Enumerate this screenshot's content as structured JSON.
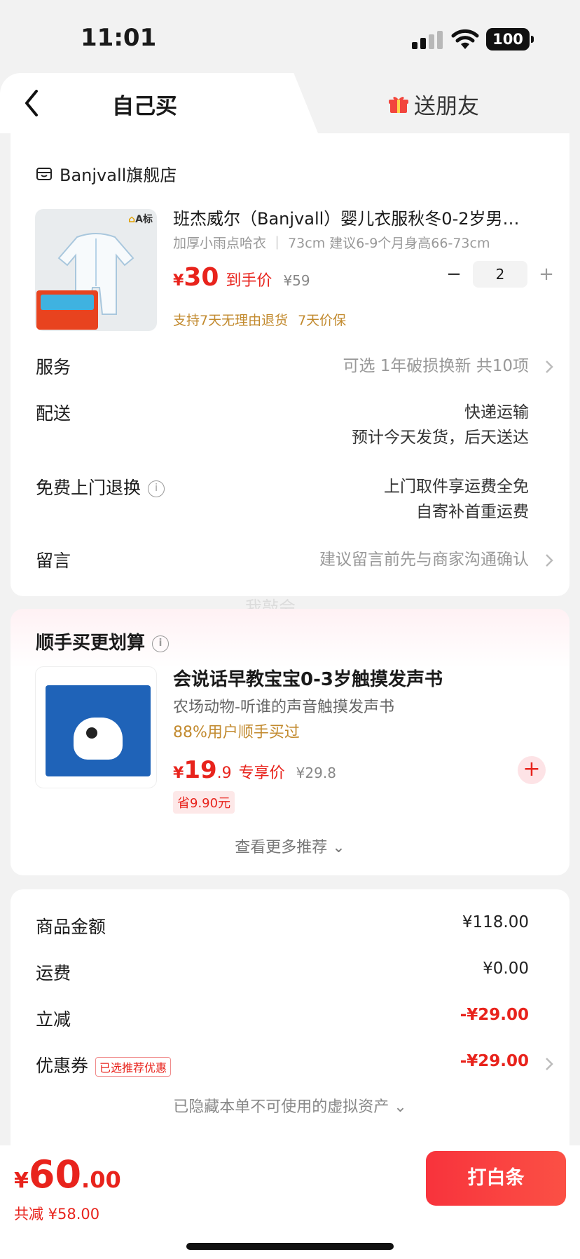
{
  "status_bar": {
    "time": "11:01",
    "battery": "100"
  },
  "tabs": {
    "self": "自己买",
    "gift": "送朋友"
  },
  "store": {
    "name": "Banjvall旗舰店"
  },
  "product": {
    "badge": "A标",
    "title": "班杰威尔（Banjvall）婴儿衣服秋冬0-2岁男…",
    "spec": "加厚小雨点哈衣 ｜ 73cm 建议6-9个月身高66-73cm",
    "currency": "¥",
    "price": "30",
    "price_label": "到手价",
    "original_price": "¥59",
    "quantity": "2",
    "minus": "−",
    "plus": "+",
    "guarantee_1": "支持7天无理由退货",
    "guarantee_2": "7天价保"
  },
  "order_rows": {
    "service_label": "服务",
    "service_value": "可选 1年破损换新 共10项",
    "delivery_label": "配送",
    "delivery_line1": "快递运输",
    "delivery_line2": "预计今天发货，后天送达",
    "return_label": "免费上门退换",
    "return_line1": "上门取件享运费全免",
    "return_line2": "自寄补首重运费",
    "note_label": "留言",
    "note_value": "建议留言前先与商家沟通确认"
  },
  "watermark": "我敲会",
  "recommend": {
    "title": "顺手买更划算",
    "name": "会说话早教宝宝0-3岁触摸发声书",
    "subtitle": "农场动物-听谁的声音触摸发声书",
    "rate": "88%用户顺手买过",
    "currency": "¥",
    "price_int": "19",
    "price_dec": ".9",
    "price_label": "专享价",
    "original_price": "¥29.8",
    "save": "省9.90元",
    "add": "+",
    "more": "查看更多推荐 ⌄"
  },
  "summary": {
    "goods_label": "商品金额",
    "goods_value": "¥118.00",
    "shipping_label": "运费",
    "shipping_value": "¥0.00",
    "discount_label": "立减",
    "discount_value": "-¥29.00",
    "coupon_label": "优惠券",
    "coupon_tag": "已选推荐优惠",
    "coupon_value": "-¥29.00",
    "hidden_assets": "已隐藏本单不可使用的虚拟资产 ⌄"
  },
  "footer": {
    "currency": "¥",
    "total_int": "60",
    "total_dec": ".00",
    "saved": "共减 ¥58.00",
    "pay_button": "打白条"
  },
  "colors": {
    "accent_red": "#e8231c",
    "gold": "#c28a2e"
  }
}
